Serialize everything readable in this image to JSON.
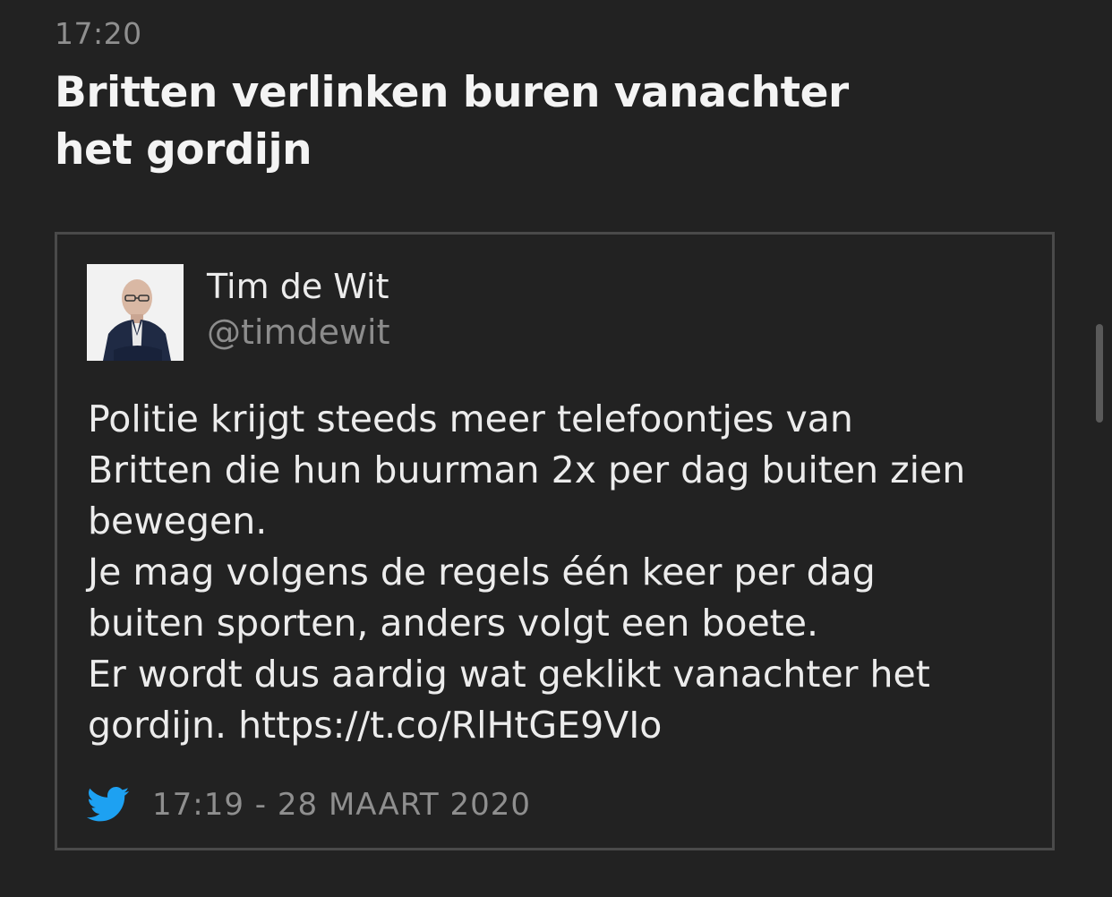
{
  "header": {
    "time": "17:20",
    "title_lines": [
      "Britten verlinken buren vanachter",
      "het gordijn"
    ]
  },
  "tweet": {
    "author_name": "Tim de Wit",
    "author_handle": "@timdewit",
    "text_lines": [
      "Politie krijgt steeds meer telefoontjes van",
      "Britten die hun buurman 2x per dag buiten zien",
      "bewegen.",
      "Je mag volgens de regels één keer per dag",
      "buiten sporten, anders volgt een boete.",
      "Er wordt dus aardig wat geklikt vanachter het",
      "gordijn. https://t.co/RlHtGE9VIo"
    ],
    "timestamp": "17:19 - 28 MAART 2020",
    "source_icon": "twitter-bird-icon"
  },
  "colors": {
    "background": "#222222",
    "twitter_blue": "#1da1f2",
    "border": "#4a4a4a"
  }
}
